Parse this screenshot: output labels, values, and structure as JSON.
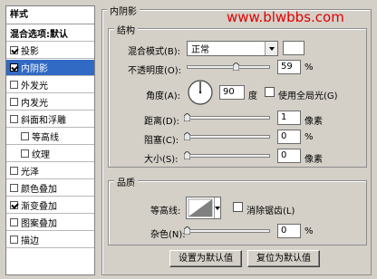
{
  "watermark": "www.blwbbs.com",
  "styles_panel": {
    "header": "样式",
    "blend_options": "混合选项:默认",
    "items": [
      {
        "label": "投影",
        "checked": true
      },
      {
        "label": "内阴影",
        "checked": true
      },
      {
        "label": "外发光",
        "checked": false
      },
      {
        "label": "内发光",
        "checked": false
      },
      {
        "label": "斜面和浮雕",
        "checked": false
      },
      {
        "label": "等高线",
        "checked": false
      },
      {
        "label": "纹理",
        "checked": false
      },
      {
        "label": "光泽",
        "checked": false
      },
      {
        "label": "颜色叠加",
        "checked": false
      },
      {
        "label": "渐变叠加",
        "checked": true
      },
      {
        "label": "图案叠加",
        "checked": false
      },
      {
        "label": "描边",
        "checked": false
      }
    ]
  },
  "panel_title": "内阴影",
  "structure": {
    "title": "结构",
    "blend_mode_label": "混合模式(B):",
    "blend_mode_value": "正常",
    "opacity_label": "不透明度(O):",
    "opacity_value": "59",
    "opacity_unit": "%",
    "opacity_level": 0.59,
    "angle_label": "角度(A):",
    "angle_value": "90",
    "angle_unit": "度",
    "global_light_label": "使用全局光(G)",
    "global_light_checked": false,
    "distance_label": "距离(D):",
    "distance_value": "1",
    "distance_unit": "像素",
    "choke_label": "阻塞(C):",
    "choke_value": "0",
    "choke_unit": "%",
    "size_label": "大小(S):",
    "size_value": "0",
    "size_unit": "像素"
  },
  "quality": {
    "title": "品质",
    "contour_label": "等高线:",
    "anti_alias_label": "消除锯齿(L)",
    "anti_alias_checked": false,
    "noise_label": "杂色(N):",
    "noise_value": "0",
    "noise_unit": "%"
  },
  "buttons": {
    "make_default": "设置为默认值",
    "reset_default": "复位为默认值"
  }
}
